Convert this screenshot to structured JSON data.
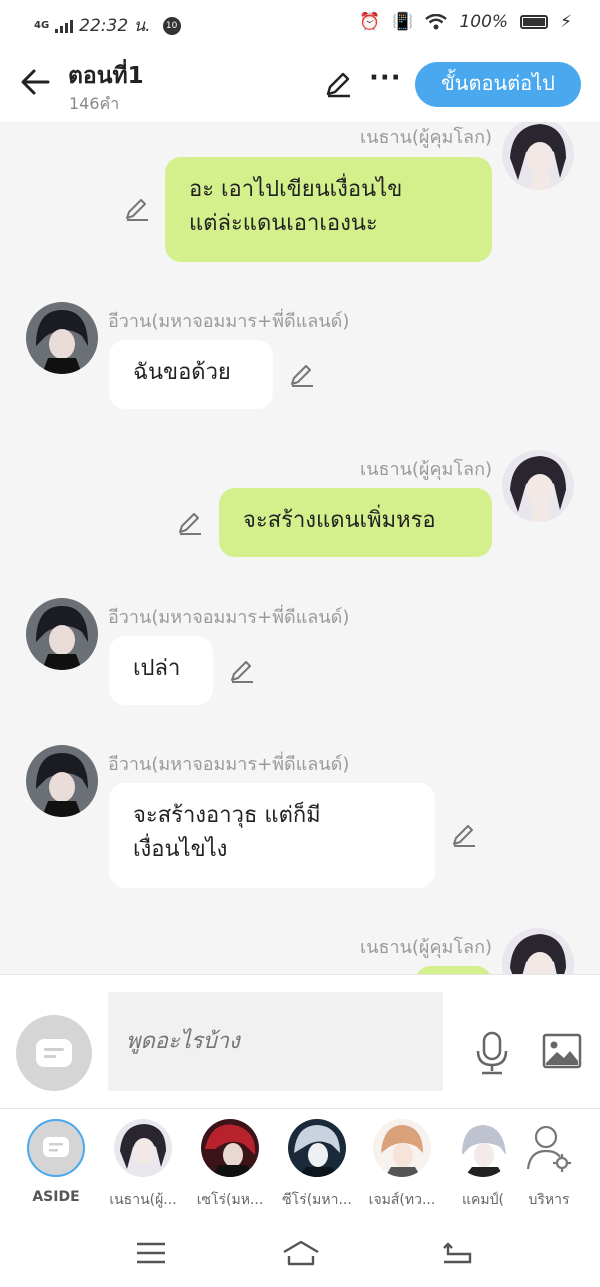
{
  "status": {
    "network": "4G",
    "time": "22:32 น.",
    "notif_count": "10",
    "battery": "100%"
  },
  "header": {
    "title": "ตอนที่1",
    "word_count": "146คำ",
    "next_button": "ขั้นตอนต่อไป"
  },
  "messages": [
    {
      "sender": "เนธาน(ผู้คุมโลก)",
      "side": "me",
      "text_lines": [
        "อะ เอาไปเขียนเงื่อนไข",
        "แต่ล่ะแดนเอาเองนะ"
      ]
    },
    {
      "sender": "อีวาน(มหาจอมมาร+พี่ดีแลนด์)",
      "side": "them",
      "text_lines": [
        "ฉันขอด้วย"
      ]
    },
    {
      "sender": "เนธาน(ผู้คุมโลก)",
      "side": "me",
      "text_lines": [
        "จะสร้างแดนเพิ่มหรอ"
      ]
    },
    {
      "sender": "อีวาน(มหาจอมมาร+พี่ดีแลนด์)",
      "side": "them",
      "text_lines": [
        "เปล่า"
      ]
    },
    {
      "sender": "อีวาน(มหาจอมมาร+พี่ดีแลนด์)",
      "side": "them",
      "text_lines": [
        "จะสร้างอาวุธ แต่ก็มี",
        "เงื่อนไขไง"
      ]
    },
    {
      "sender": "เนธาน(ผู้คุมโลก)",
      "side": "me",
      "text_lines": [
        ""
      ]
    }
  ],
  "input": {
    "placeholder": "พูดอะไรบ้าง"
  },
  "characters": [
    {
      "label": "ASIDE"
    },
    {
      "label": "เนธาน(ผู้..."
    },
    {
      "label": "เซโร่(มห..."
    },
    {
      "label": "ซีโร่(มหา..."
    },
    {
      "label": "เจมส์(ทว..."
    },
    {
      "label": "แคมป์("
    },
    {
      "label": "บริหาร"
    }
  ],
  "colors": {
    "accent": "#4aa8ef",
    "my_bubble": "#d3f08c",
    "their_bubble": "#ffffff",
    "background": "#f5f5f5"
  }
}
